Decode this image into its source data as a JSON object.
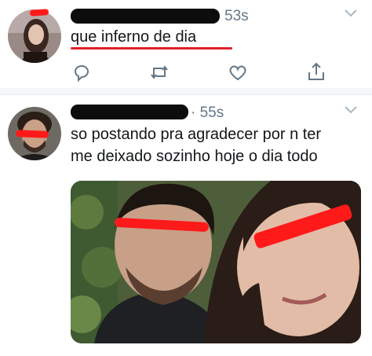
{
  "tweets": [
    {
      "time": "53s",
      "text": "que inferno de dia",
      "actions": {
        "reply_icon": "reply-icon",
        "retweet_icon": "retweet-icon",
        "like_icon": "like-icon",
        "share_icon": "share-icon"
      }
    },
    {
      "time": "· 55s",
      "text_line1": "so postando pra agradecer por n ter",
      "text_line2": "me deixado sozinho hoje o dia todo",
      "media": "photo"
    }
  ],
  "colors": {
    "timestamp": "#657786",
    "redaction": "#ff1a1a",
    "icon": "#657786",
    "divider": "#e6ecf0"
  }
}
